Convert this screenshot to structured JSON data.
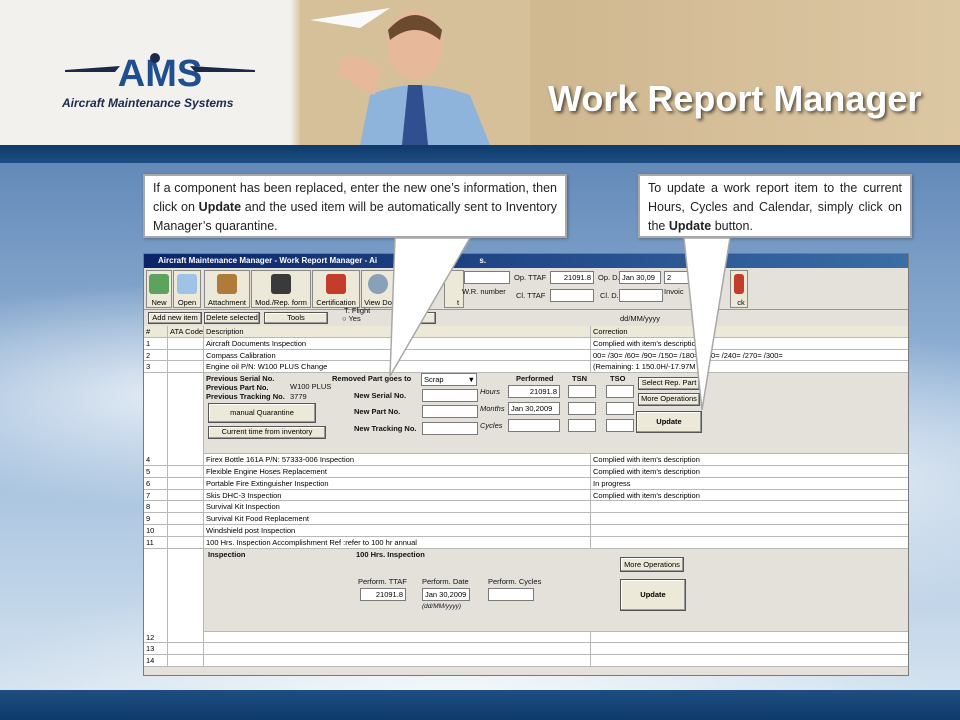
{
  "header": {
    "logo_text": "AMS",
    "logo_subtitle": "Aircraft Maintenance Systems",
    "title": "Work Report Manager",
    "colors": {
      "title": "#ffffff",
      "bar": "#0e3a6a"
    }
  },
  "callout_left": {
    "text_1": "If a component has been replaced, enter the new one’s information, then click on ",
    "bold_1": "Update",
    "text_2": " and the used item will be automatically sent to Inventory Manager’s quarantine."
  },
  "callout_right": {
    "text_1": "To update a work report item to the current Hours, Cycles and Calendar, simply click on the ",
    "bold_1": "Update",
    "text_2": " button."
  },
  "app": {
    "window_title": "Aircraft Maintenance Manager - Work Report Manager - Ai",
    "window_title_tail": "s.",
    "toolbar": {
      "new": "New",
      "open": "Open",
      "attachment": "Attachment",
      "mod_rep": "Mod./Rep. form",
      "certification": "Certification",
      "view": "View Do",
      "t_fragment": "t",
      "lock_fragment": "ck"
    },
    "info": {
      "wr_number_label": "W.R. number",
      "op_ttaf_label": "Op. TTAF",
      "op_ttaf_value": "21091.8",
      "op_d_label": "Op. D.",
      "op_d_value": "Jan 30,09",
      "op_d_extra": "2",
      "cl_ttaf_label": "Cl. TTAF",
      "cl_d_label": "Cl. D.",
      "invoice_label": "Invoic",
      "t_flight_label": "T. Flight",
      "yes_label": "Yes",
      "date_hint": "dd/MM/yyyy"
    },
    "actions": {
      "add": "Add new item",
      "delete": "Delete selected",
      "tools": "Tools"
    },
    "columns": {
      "num": "#",
      "ata": "ATA Code",
      "desc": "Description",
      "corr": "Correction"
    },
    "rows_top": [
      {
        "n": "1",
        "desc": "Aircraft Documents  Inspection",
        "corr": "Complied with item's description"
      },
      {
        "n": "2",
        "desc": "Compass  Calibration",
        "corr": "00=   /30=   /60=   /90=          /150=   /180=   /210=   /240=   /270=   /300="
      },
      {
        "n": "3",
        "desc": "Engine oil  P/N: W100 PLUS Change",
        "corr": "(Remaining: 1 150.0H/-17.97M"
      }
    ],
    "detail3": {
      "prev_serial": "Previous Serial No.",
      "prev_part": "Previous Part No.",
      "prev_part_value": "W100 PLUS",
      "prev_tracking": "Previous Tracking No.",
      "prev_tracking_value": "3779",
      "manual_quarantine": "manual Quarantine",
      "current_time": "Current time from inventory",
      "removed_part": "Removed Part goes to",
      "removed_value": "Scrap",
      "new_serial": "New Serial No.",
      "new_part": "New Part No.",
      "new_tracking": "New Tracking No.",
      "performed": "Performed",
      "tsn": "TSN",
      "tso": "TSO",
      "hours": "Hours",
      "hours_value": "21091.8",
      "months": "Months",
      "months_value": "Jan 30,2009",
      "cycles": "Cycles",
      "select_rep": "Select Rep. Part",
      "more_ops": "More Operations",
      "update": "Update"
    },
    "rows_mid": [
      {
        "n": "4",
        "desc": "Firex Bottle 161A P/N: 57333-006 Inspection",
        "corr": "Complied with item's description"
      },
      {
        "n": "5",
        "desc": "Flexible Engine Hoses  Replacement",
        "corr": "Complied with item's description"
      },
      {
        "n": "6",
        "desc": "Portable Fire Extinguisher  Inspection",
        "corr": "In progress"
      },
      {
        "n": "7",
        "desc": "Skis DHC-3 Inspection",
        "corr": "Complied with item's description"
      },
      {
        "n": "8",
        "desc": "Survival Kit  Inspection",
        "corr": ""
      },
      {
        "n": "9",
        "desc": "Survival Kit Food  Replacement",
        "corr": ""
      },
      {
        "n": "10",
        "desc": "Windshield post  Inspection",
        "corr": ""
      },
      {
        "n": "11",
        "desc": "100 Hrs. Inspection Accomplishment Ref :refer to 100 hr annual",
        "corr": ""
      }
    ],
    "detail11": {
      "inspection": "Inspection",
      "hundred": "100 Hrs. Inspection",
      "perf_ttaf": "Perform. TTAF",
      "perf_ttaf_value": "21091.8",
      "perf_date": "Perform. Date",
      "perf_date_value": "Jan 30,2009",
      "perf_date_hint": "(dd/MM/yyyy)",
      "perf_cycles": "Perform. Cycles",
      "more_ops": "More Operations",
      "update": "Update"
    },
    "rows_bottom": [
      {
        "n": "12"
      },
      {
        "n": "13"
      },
      {
        "n": "14"
      }
    ]
  }
}
